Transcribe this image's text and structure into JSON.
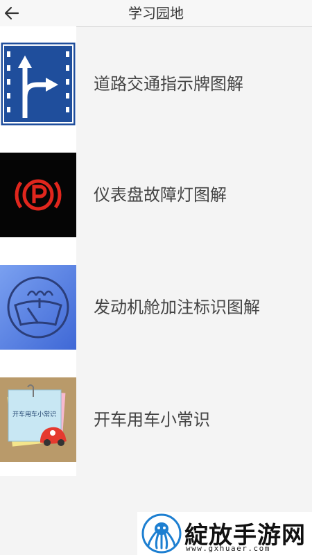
{
  "header": {
    "title": "学习园地",
    "back_icon": "arrow-left-icon"
  },
  "items": [
    {
      "label": "道路交通指示牌图解",
      "icon": "traffic-sign-icon",
      "bg": "#ffffff"
    },
    {
      "label": "仪表盘故障灯图解",
      "icon": "parking-brake-warning-icon",
      "bg": "#000000"
    },
    {
      "label": "发动机舱加注标识图解",
      "icon": "windshield-washer-icon",
      "bg": "#5b7fe0"
    },
    {
      "label": "开车用车小常识",
      "icon": "car-notes-icon",
      "bg": "#b99a6a",
      "thumb_text": "开车用车小常识"
    }
  ],
  "watermark": {
    "text": "綻放手游网",
    "url": "www.gxhuaer.com"
  }
}
